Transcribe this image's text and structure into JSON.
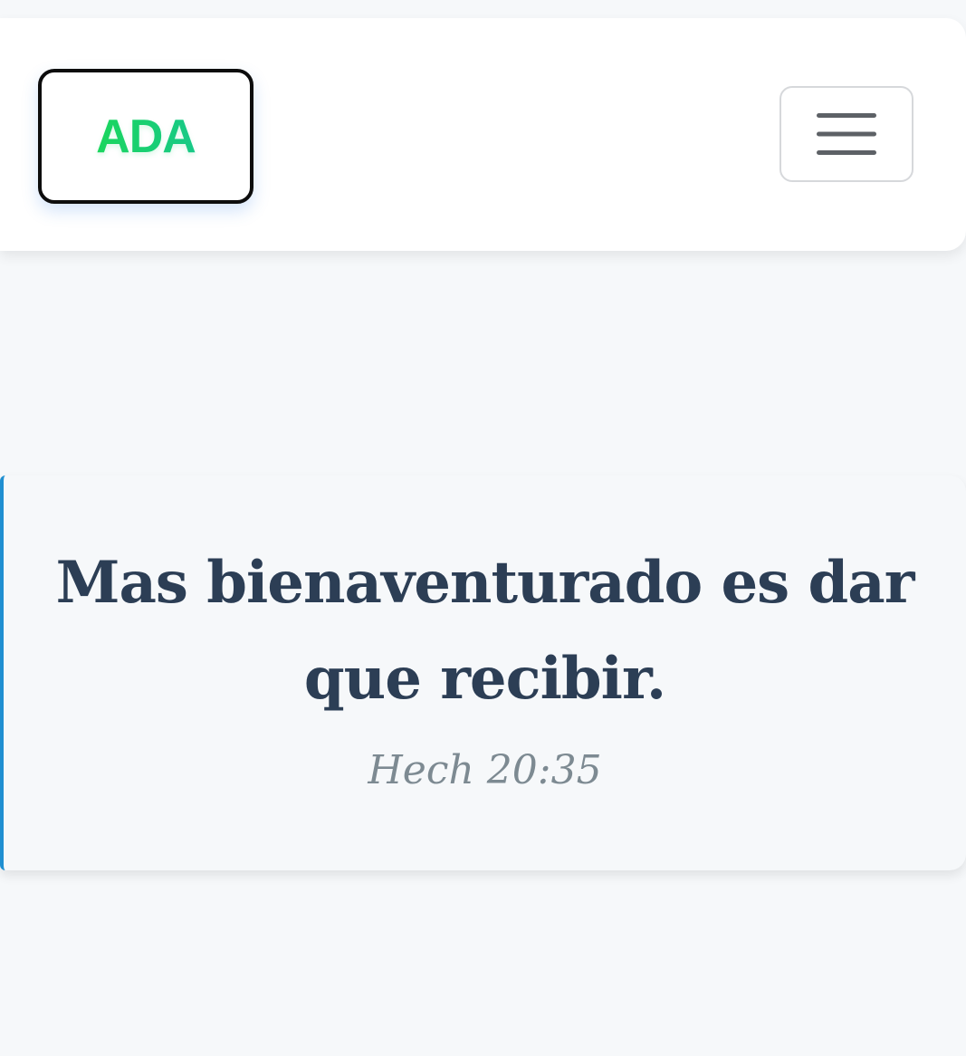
{
  "header": {
    "logo_text": "ADA",
    "menu_icon": "hamburger-icon"
  },
  "verse": {
    "text": "Mas bienaventurado es dar que recibir.",
    "reference": "Hech 20:35"
  },
  "colors": {
    "logo_gradient_start": "#1bd85c",
    "logo_gradient_end": "#19c98b",
    "quote_text": "#2c3e55",
    "reference_text": "#7d8a92",
    "accent_border": "#1f8fd1",
    "background": "#f6f8fa"
  }
}
